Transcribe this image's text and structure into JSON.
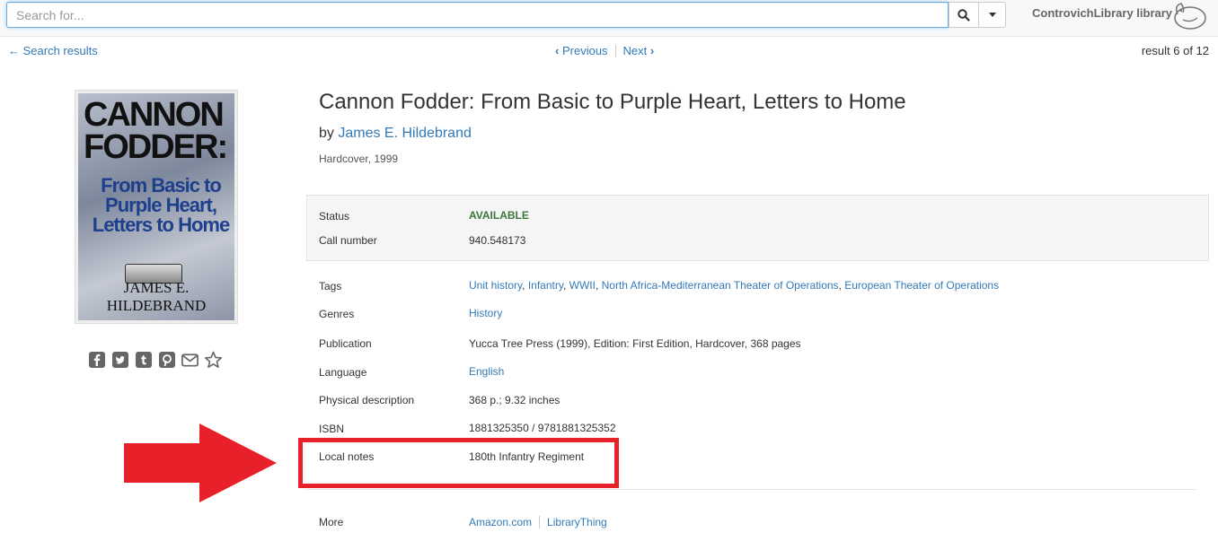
{
  "search": {
    "placeholder": "Search for..."
  },
  "brand": {
    "name": "ControvichLibrary library"
  },
  "nav": {
    "back_label": "Search results",
    "previous_label": "Previous",
    "next_label": "Next",
    "result_count": "result 6 of 12"
  },
  "cover": {
    "title_line1": "CANNON",
    "title_line2": "FODDER:",
    "subtitle": "From Basic to Purple Heart, Letters to Home",
    "author": "JAMES E. HILDEBRAND"
  },
  "book": {
    "title": "Cannon Fodder: From Basic to Purple Heart, Letters to Home",
    "by": "by",
    "author": "James E. Hildebrand",
    "format": "Hardcover, 1999"
  },
  "status": {
    "status_label": "Status",
    "status_value": "AVAILABLE",
    "call_label": "Call number",
    "call_value": "940.548173"
  },
  "details": {
    "tags_label": "Tags",
    "tags": [
      "Unit history",
      "Infantry",
      "WWII",
      "North Africa-Mediterranean Theater of Operations",
      "European Theater of Operations"
    ],
    "genres_label": "Genres",
    "genres": "History",
    "publication_label": "Publication",
    "publication": "Yucca Tree Press (1999), Edition: First Edition, Hardcover, 368 pages",
    "language_label": "Language",
    "language": "English",
    "physical_label": "Physical description",
    "physical": "368 p.; 9.32 inches",
    "isbn_label": "ISBN",
    "isbn": "1881325350 / 9781881325352",
    "local_notes_label": "Local notes",
    "local_notes": "180th Infantry Regiment",
    "more_label": "More",
    "more_links": [
      "Amazon.com",
      "LibraryThing"
    ]
  },
  "colors": {
    "link": "#337ab7",
    "available": "#3c763d",
    "highlight": "#e8202a"
  },
  "icons": [
    "search-icon",
    "caret-down-icon",
    "arrow-left-icon",
    "chevron-left-icon",
    "chevron-right-icon",
    "facebook-icon",
    "twitter-icon",
    "tumblr-icon",
    "pinterest-icon",
    "email-icon",
    "star-icon"
  ]
}
